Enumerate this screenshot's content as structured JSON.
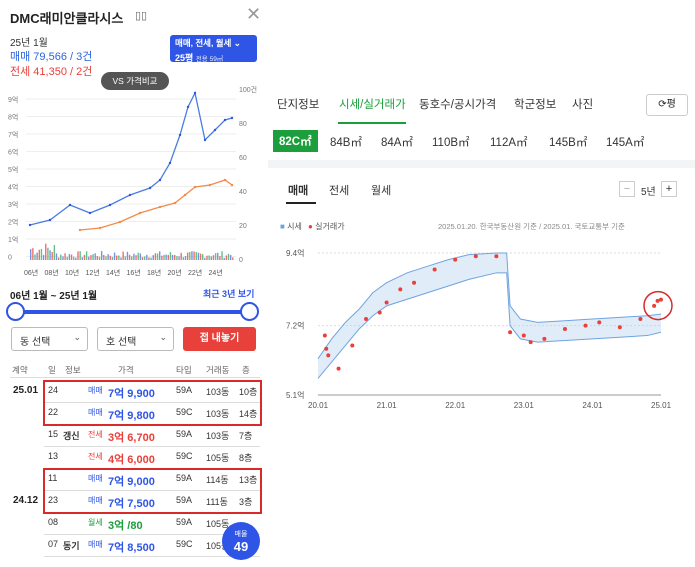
{
  "header": {
    "title": "DMC래미안클라시스",
    "year_month": "25년 1월",
    "sale_summary": "매매 79,566 / 3건",
    "rent_summary": "전세 41,350 / 2건"
  },
  "filter": {
    "line1": "매매, 전세, 월세",
    "line2": "25평",
    "line2_sub": "전용 59㎡"
  },
  "compare_button": "VS 가격비교",
  "mini_chart": {
    "y_left": [
      "9억",
      "8억",
      "7억",
      "6억",
      "5억",
      "4억",
      "3억",
      "2억",
      "1억",
      "0"
    ],
    "y_right": [
      "100건",
      "80",
      "60",
      "40",
      "20",
      "0"
    ],
    "x_labels": [
      "06년",
      "08년",
      "10년",
      "12년",
      "14년",
      "16년",
      "18년",
      "20년",
      "22년",
      "24년"
    ]
  },
  "period": {
    "label": "06년 1월 ~ 25년 1월",
    "recent_link": "최근 3년 보기"
  },
  "selects": {
    "dong": "동 선택",
    "ho": "호 선택",
    "submit": "접 내놓기"
  },
  "table": {
    "headers": [
      "계약",
      "일",
      "정보",
      "가격",
      "타입",
      "거래동",
      "층"
    ],
    "rows": [
      {
        "date": "25.01",
        "day": "24",
        "info": "",
        "kind": "매매",
        "price": "7억 9,900",
        "type": "59A",
        "bld": "103동",
        "floor": "10층",
        "color": "blue"
      },
      {
        "date": "",
        "day": "22",
        "info": "",
        "kind": "매매",
        "price": "7억 9,800",
        "type": "59C",
        "bld": "103동",
        "floor": "14층",
        "color": "blue"
      },
      {
        "date": "",
        "day": "15",
        "info": "갱신",
        "kind": "전세",
        "price": "3억 6,700",
        "type": "59A",
        "bld": "103동",
        "floor": "7층",
        "color": "red"
      },
      {
        "date": "",
        "day": "13",
        "info": "",
        "kind": "전세",
        "price": "4억 6,000",
        "type": "59C",
        "bld": "105동",
        "floor": "8층",
        "color": "red"
      },
      {
        "date": "",
        "day": "11",
        "info": "",
        "kind": "매매",
        "price": "7억 9,000",
        "type": "59A",
        "bld": "114동",
        "floor": "13층",
        "color": "blue"
      },
      {
        "date": "24.12",
        "day": "23",
        "info": "",
        "kind": "매매",
        "price": "7억 7,500",
        "type": "59A",
        "bld": "111동",
        "floor": "3층",
        "color": "blue"
      },
      {
        "date": "",
        "day": "08",
        "info": "",
        "kind": "월세",
        "price": "3억 /80",
        "type": "59A",
        "bld": "105동",
        "floor": "",
        "color": "green"
      },
      {
        "date": "",
        "day": "07",
        "info": "동기",
        "kind": "매매",
        "price": "7억 8,500",
        "type": "59C",
        "bld": "105동",
        "floor": "",
        "color": "blue"
      }
    ]
  },
  "badge": {
    "label": "매물",
    "count": "49"
  },
  "right_tabs": [
    "단지정보",
    "시세/실거래가",
    "동호수/공시가격",
    "학군정보",
    "사진"
  ],
  "refresh_label": "⟳평",
  "sizes": [
    "82C㎡",
    "84B㎡",
    "84A㎡",
    "110B㎡",
    "112A㎡",
    "145B㎡",
    "145A㎡"
  ],
  "market_tabs": [
    "매매",
    "전세",
    "월세"
  ],
  "year_select": "5년",
  "legend": {
    "market": "시세",
    "actual": "실거래가"
  },
  "source": "2025.01.20. 한국부동산원 기준 / 2025.01. 국토교통부 기준",
  "colors": {
    "blue": "#2e55e6",
    "red": "#e8403a",
    "green": "#1b9e3b",
    "band": "#a9c8ee"
  },
  "chart_data": {
    "type": "line",
    "y_tick_labels": [
      "9.4억",
      "7.2억",
      "5.1억"
    ],
    "x": [
      "20.01",
      "21.01",
      "22.01",
      "23.01",
      "24.01",
      "25.01"
    ],
    "ylim": [
      5.1,
      9.4
    ],
    "series": [
      {
        "name": "시세",
        "upper": [
          [
            2020.0,
            6.2
          ],
          [
            2020.2,
            6.8
          ],
          [
            2020.4,
            7.3
          ],
          [
            2020.6,
            7.7
          ],
          [
            2020.8,
            8.2
          ],
          [
            2021.0,
            8.5
          ],
          [
            2021.3,
            8.8
          ],
          [
            2021.6,
            9.0
          ],
          [
            2021.9,
            9.2
          ],
          [
            2022.2,
            9.35
          ],
          [
            2022.6,
            9.4
          ],
          [
            2022.75,
            9.4
          ],
          [
            2022.8,
            7.8
          ],
          [
            2022.95,
            7.4
          ],
          [
            2023.2,
            7.3
          ],
          [
            2023.6,
            7.35
          ],
          [
            2024.0,
            7.4
          ],
          [
            2024.4,
            7.45
          ],
          [
            2024.8,
            7.5
          ],
          [
            2025.0,
            7.55
          ]
        ],
        "lower": [
          [
            2020.0,
            5.6
          ],
          [
            2020.2,
            6.1
          ],
          [
            2020.4,
            6.6
          ],
          [
            2020.6,
            7.1
          ],
          [
            2020.8,
            7.5
          ],
          [
            2021.0,
            7.8
          ],
          [
            2021.3,
            8.0
          ],
          [
            2021.6,
            8.2
          ],
          [
            2021.9,
            8.4
          ],
          [
            2022.2,
            8.6
          ],
          [
            2022.6,
            8.8
          ],
          [
            2022.75,
            8.8
          ],
          [
            2022.8,
            7.2
          ],
          [
            2022.95,
            6.8
          ],
          [
            2023.2,
            6.7
          ],
          [
            2023.6,
            6.75
          ],
          [
            2024.0,
            6.8
          ],
          [
            2024.4,
            6.85
          ],
          [
            2024.8,
            6.9
          ],
          [
            2025.0,
            7.0
          ]
        ]
      },
      {
        "name": "실거래가",
        "points": [
          [
            2020.1,
            6.9
          ],
          [
            2020.12,
            6.5
          ],
          [
            2020.15,
            6.3
          ],
          [
            2020.3,
            5.9
          ],
          [
            2020.5,
            6.6
          ],
          [
            2020.7,
            7.4
          ],
          [
            2020.9,
            7.6
          ],
          [
            2021.0,
            7.9
          ],
          [
            2021.2,
            8.3
          ],
          [
            2021.4,
            8.5
          ],
          [
            2021.7,
            8.9
          ],
          [
            2022.0,
            9.2
          ],
          [
            2022.3,
            9.3
          ],
          [
            2022.6,
            9.3
          ],
          [
            2022.8,
            7.0
          ],
          [
            2023.0,
            6.9
          ],
          [
            2023.1,
            6.7
          ],
          [
            2023.3,
            6.8
          ],
          [
            2023.6,
            7.1
          ],
          [
            2023.9,
            7.2
          ],
          [
            2024.1,
            7.3
          ],
          [
            2024.4,
            7.15
          ],
          [
            2024.7,
            7.4
          ],
          [
            2024.9,
            7.8
          ],
          [
            2024.95,
            7.95
          ],
          [
            2025.0,
            7.99
          ]
        ]
      }
    ]
  }
}
